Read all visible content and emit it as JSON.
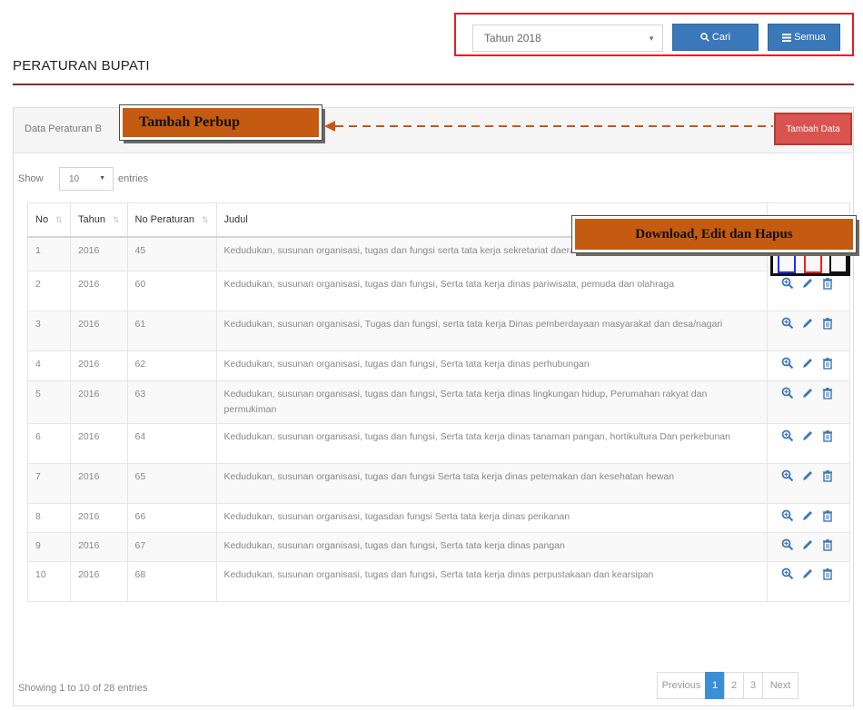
{
  "filter": {
    "year_value": "Tahun 2018",
    "search_label": "Cari",
    "all_label": "Semua"
  },
  "page": {
    "title": "PERATURAN BUPATI"
  },
  "panel": {
    "title": "Data Peraturan B",
    "add_button": "Tambah Data"
  },
  "callouts": {
    "add": "Tambah Perbup",
    "actions": "Download, Edit dan Hapus"
  },
  "length": {
    "show": "Show",
    "value": "10",
    "entries": "entries"
  },
  "table": {
    "headers": [
      "No",
      "Tahun",
      "No Peraturan",
      "Judul"
    ],
    "rows": [
      {
        "no": "1",
        "tahun": "2016",
        "nomor": "45",
        "judul": "Kedudukan, susunan organisasi, tugas dan fungsi serta tata kerja sekretariat daerah"
      },
      {
        "no": "2",
        "tahun": "2016",
        "nomor": "60",
        "judul": "Kedudukan, susunan organisasi, tugas dan fungsi, Serta tata kerja dinas pariwisata, pemuda dan olahraga"
      },
      {
        "no": "3",
        "tahun": "2016",
        "nomor": "61",
        "judul": "Kedudukan, susunan organisasi, Tugas dan fungsi, serta tata kerja Dinas pemberdayaan masyarakat dan desa/nagari"
      },
      {
        "no": "4",
        "tahun": "2016",
        "nomor": "62",
        "judul": "Kedudukan, susunan organisasi, tugas dan fungsi, Serta tata kerja dinas perhubungan"
      },
      {
        "no": "5",
        "tahun": "2016",
        "nomor": "63",
        "judul": "Kedudukan, susunan organisasi, tugas dan fungsi, Serta tata kerja dinas lingkungan hidup, Perumahan rakyat dan permukiman"
      },
      {
        "no": "6",
        "tahun": "2016",
        "nomor": "64",
        "judul": "Kedudukan, susunan organisasi, tugas dan fungsi, Serta tata kerja dinas tanaman pangan, hortikultura Dan perkebunan"
      },
      {
        "no": "7",
        "tahun": "2016",
        "nomor": "65",
        "judul": "Kedudukan, susunan organisasi, tugas dan fungsi Serta tata kerja dinas peternakan dan kesehatan hewan"
      },
      {
        "no": "8",
        "tahun": "2016",
        "nomor": "66",
        "judul": "Kedudukan, susunan organisasi, tugasdan fungsi Serta tata kerja dinas perikanan"
      },
      {
        "no": "9",
        "tahun": "2016",
        "nomor": "67",
        "judul": "Kedudukan, susunan organisasi, tugas dan fungsi, Serta tata kerja dinas pangan"
      },
      {
        "no": "10",
        "tahun": "2016",
        "nomor": "68",
        "judul": "Kedudukan, susunan organisasi, tugas dan fungsi, Serta tata kerja dinas perpustakaan dan kearsipan"
      }
    ]
  },
  "footer": {
    "info": "Showing 1 to 10 of 28 entries",
    "previous": "Previous",
    "pages": [
      "1",
      "2",
      "3"
    ],
    "next": "Next"
  },
  "colors": {
    "primary": "#3a78b9",
    "danger": "#d9534f",
    "callout": "#c55a11",
    "title_rule": "#8a2b2b",
    "page_active": "#3a8fd6"
  },
  "icons": {
    "search": "search-icon",
    "all": "list-icon",
    "view": "zoom-icon",
    "edit": "pencil-icon",
    "delete": "trash-icon"
  }
}
